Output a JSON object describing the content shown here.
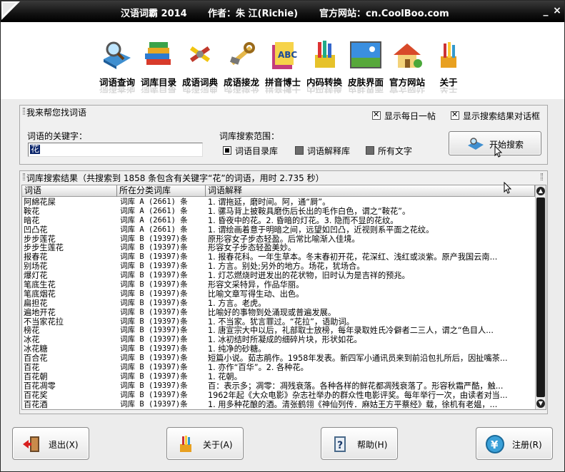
{
  "title": {
    "app": "汉语词霸 2014",
    "author": "作者：朱 江(Richie)",
    "site": "官方网站：cn.CoolBoo.com"
  },
  "window_controls": {
    "minimize": "_",
    "close": "×"
  },
  "toolbar": [
    {
      "label": "词语查询",
      "icon": "book-search-icon"
    },
    {
      "label": "词库目录",
      "icon": "books-icon"
    },
    {
      "label": "成语词典",
      "icon": "tools-icon"
    },
    {
      "label": "成语接龙",
      "icon": "wrench-icon"
    },
    {
      "label": "拼音博士",
      "icon": "abc-book-icon"
    },
    {
      "label": "内码转换",
      "icon": "pencils-icon"
    },
    {
      "label": "皮肤界面",
      "icon": "landscape-icon"
    },
    {
      "label": "官方网站",
      "icon": "house-icon"
    },
    {
      "label": "关于",
      "icon": "pencil-cup-icon"
    }
  ],
  "search": {
    "panel_title": "我来帮您找词语",
    "show_daily": "显示每日一帖",
    "show_result_dialog": "显示搜索结果对话框",
    "keyword_label": "词语的关键字：",
    "keyword_value": "花",
    "scope_label": "词库搜索范围：",
    "scope_options": [
      "词语目录库",
      "词语解释库",
      "所有文字"
    ],
    "start_button": "开始搜索"
  },
  "results": {
    "title": "词库搜索结果（共搜索到 1858 条包含有关键字“花”的词语，用时 2.735 秒）",
    "columns": [
      "词语",
      "所在分类词库",
      "词语解释"
    ],
    "rows": [
      [
        "阿綿花屎",
        "词库 A (2661) 条",
        "1. 谓拖延，磨时间。阿，通“屙”。"
      ],
      [
        "鞍花",
        "词库 A (2661) 条",
        "1. 骡马背上披鞍具磨伤后长出的毛作白色，谓之“鞍花”。"
      ],
      [
        "暗花",
        "词库 A (2661) 条",
        "1. 昏夜中的花。2. 昏暗的灯花。3. 隐而不显的花纹。"
      ],
      [
        "凹凸花",
        "词库 A (2661) 条",
        "1. 谓绘画着意于明暗之间，远望如凹凸，近视则系平面之花纹。"
      ],
      [
        "步步莲花",
        "词库 B (19397)条",
        "原形容女子步态轻盈。后常比喻渐入佳境。"
      ],
      [
        "步步生莲花",
        "词库 B (19397)条",
        "形容女子步态轻盈美妙。"
      ],
      [
        "报春花",
        "词库 B (19397)条",
        "1. 报春花科。一年生草本。冬末春初开花，花深红、浅红或淡紫。原产我国云南..."
      ],
      [
        "别场花",
        "词库 B (19397)条",
        "1. 方言。别处;另外的地方。场花，犹场合。"
      ],
      [
        "爆灯花",
        "词库 B (19397)条",
        "1. 灯芯燃烧时迸发出的花状物，旧时认为是吉祥的预兆。"
      ],
      [
        "笔底生花",
        "词库 B (19397)条",
        "形容文采特异，作品华丽。"
      ],
      [
        "笔底烟花",
        "词库 B (19397)条",
        "比喻文章写得生动、出色。"
      ],
      [
        "扁担花",
        "词库 B (19397)条",
        "1. 方言。老虎。"
      ],
      [
        "遍地开花",
        "词库 B (19397)条",
        "比喻好的事物到处涌现或普遍发展。"
      ],
      [
        "不当家花拉",
        "词库 B (19397)条",
        "1. 不当家。犹言罪过。“花拉”，语助词。"
      ],
      [
        "榜花",
        "词库 B (19397)条",
        "1. 唐宣宗大中以后，礼部取士放榜，每年录取姓氏冷僻者二三人，谓之“色目人..."
      ],
      [
        "冰花",
        "词库 B (19397)条",
        "1. 冰初结时所凝成的细碎片块，形状如花。"
      ],
      [
        "冰花糖",
        "词库 B (19397)条",
        "1. 纯净的砂糖。"
      ],
      [
        "百合花",
        "词库 B (19397)条",
        "短篇小说。茹志鹃作。1958年发表。新四军小通讯员来到前沿包扎所后，因扯嘴茶..."
      ],
      [
        "百花",
        "词库 B (19397)条",
        "1. 亦作“百华”。2. 各种花。"
      ],
      [
        "百花朝",
        "词库 B (19397)条",
        "1. 花朝。"
      ],
      [
        "百花凋零",
        "词库 B (19397)条",
        "百：表示多；凋零：凋残衰落。各种各样的鲜花都凋残衰落了。形容秋霜严酷，触..."
      ],
      [
        "百花奖",
        "词库 B (19397)条",
        "1962年起《大众电影》杂志社举办的群众性电影评奖。每年举行一次，由读者对当..."
      ],
      [
        "百花酒",
        "词库 B (19397)条",
        "1. 用多种花酿的酒。清张鹤翎《神仙列传．麻姑王方平蔡经》载，徐机有老媪，..."
      ]
    ]
  },
  "bottom_buttons": [
    {
      "label": "退出(X)",
      "icon": "exit-door-icon"
    },
    {
      "label": "关于(A)",
      "icon": "about-pencil-icon"
    },
    {
      "label": "帮助(H)",
      "icon": "help-book-icon"
    },
    {
      "label": "注册(R)",
      "icon": "yen-coin-icon"
    }
  ]
}
